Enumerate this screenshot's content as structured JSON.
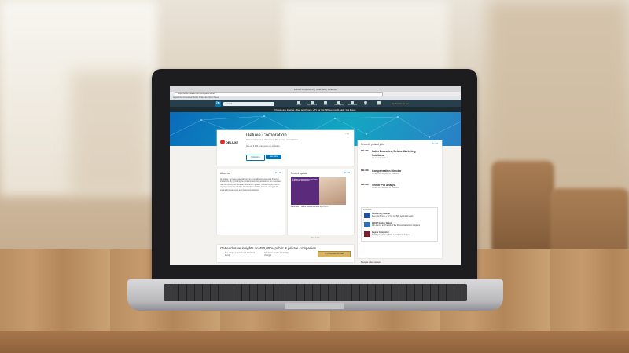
{
  "browser": {
    "tab_title": "Deluxe Corporation | Overview | LinkedIn",
    "url": "https://www.linkedin.com/company/1586/",
    "bookmarks": "Apple  iCloud  Facebook  Twitter  Wikipedia  Yahoo!  News"
  },
  "nav": {
    "logo": "in",
    "search_placeholder": "Search",
    "items": [
      "Home",
      "My Network",
      "Jobs",
      "Messaging",
      "Notifications",
      "Me",
      "Work"
    ],
    "premium": "Try Premium for free"
  },
  "promo": {
    "text": "Choose any Internet - then add Phone + TV for just $20 per month each. Get it now."
  },
  "company": {
    "logo_text": "DELUXE",
    "name": "Deluxe Corporation",
    "subtitle": "Financial Services · Shoreview, Minnesota · United States",
    "employees": "See all 3,234 employees on LinkedIn",
    "follow_label": "Following",
    "jobs_label": "See jobs",
    "more": "···"
  },
  "about": {
    "title": "About us",
    "see_all": "See all",
    "text": "At Deluxe, we're an essential partner to small businesses and financial institutions. By providing the products, services and advice you need, we help our customers achieve—and drive—growth. Deluxe Corporation is organized into three business units that combine to make us a growth engine for businesses and financial institutions."
  },
  "update": {
    "title": "Recent update",
    "see_all": "See all",
    "img_text": "6 things entrepreneurs can learn from small businesses",
    "caption": "Here are 6 of the best business tips from..."
  },
  "see_more": "See more",
  "insights": {
    "title": "Get exclusive insights on 450,000+ public & private companies",
    "item1": "See company growth and functional trends",
    "item2": "Check out notable leadership changes",
    "button": "Try Premium for free"
  },
  "jobs": {
    "title": "Recently posted jobs",
    "see_all": "See all",
    "list": [
      {
        "logo": "DELUXE",
        "title": "Sales Executive, Deluxe Marketing Solutions",
        "sub": "Greater Atlanta Area"
      },
      {
        "logo": "DELUXE",
        "title": "Compensation Director",
        "sub": "Greater Minneapolis-St. Paul Area"
      },
      {
        "logo": "DELUXE",
        "title": "Senior PCI Analyst",
        "sub": "Greater Minneapolis-St. Paul Area"
      }
    ]
  },
  "ads": {
    "label": "Promoted",
    "items": [
      {
        "title": "Choose any Internet",
        "sub": "then add Phone + TV for just $20 per month each"
      },
      {
        "title": "EVENT Gopher Nation",
        "sub": "Join alumni and friends of the Minnesota Golden Gophers"
      },
      {
        "title": "Degree Completion",
        "sub": "Finish your degree. Earn a bachelor's degree"
      }
    ]
  },
  "people_viewed": "People also viewed",
  "colors": {
    "linkedin_nav": "#283e4a",
    "linkedin_blue": "#0073b1",
    "deluxe_red": "#d82e2a",
    "premium_gold": "#d6b360"
  }
}
